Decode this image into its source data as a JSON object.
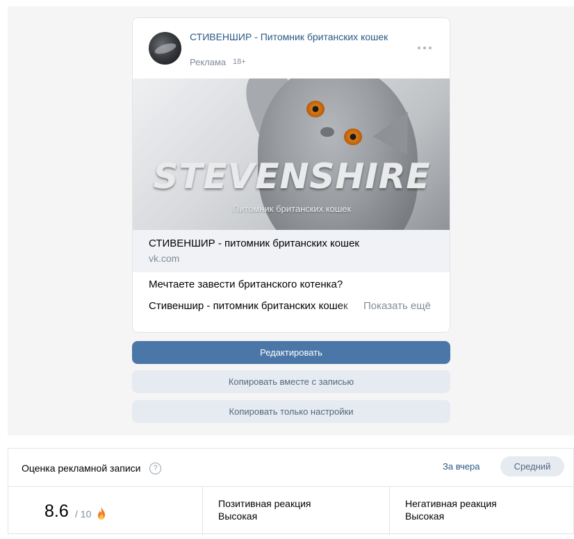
{
  "post": {
    "community_name": "СТИВЕНШИР - Питомник британских кошек",
    "ad_label": "Реклама",
    "age_rating": "18+",
    "image_title": "STEVENSHIRE",
    "image_subtitle": "Питомник британских кошек",
    "snippet_title": "СТИВЕНШИР - питомник британских кошек",
    "snippet_domain": "vk.com",
    "text_line_1": "Мечтаете завести британского котенка?",
    "text_line_2": "Стивеншир - питомник британских кошек",
    "show_more": "Показать ещё"
  },
  "buttons": {
    "edit": "Редактировать",
    "copy_with_post": "Копировать вместе с записью",
    "copy_settings_only": "Копировать только настройки"
  },
  "rating": {
    "title": "Оценка рекламной записи",
    "help": "?",
    "period": "За вчера",
    "level": "Средний",
    "score": "8.6",
    "scale": "/ 10",
    "positive_title": "Позитивная реакция",
    "positive_value": "Высокая",
    "negative_title": "Негативная реакция",
    "negative_value": "Высокая"
  },
  "colors": {
    "primary": "#4a76a8",
    "link": "#2a5885",
    "secondary_bg": "#e5ebf1",
    "muted": "#818c99"
  },
  "icons": [
    "more-icon",
    "help-icon",
    "fire-icon"
  ]
}
